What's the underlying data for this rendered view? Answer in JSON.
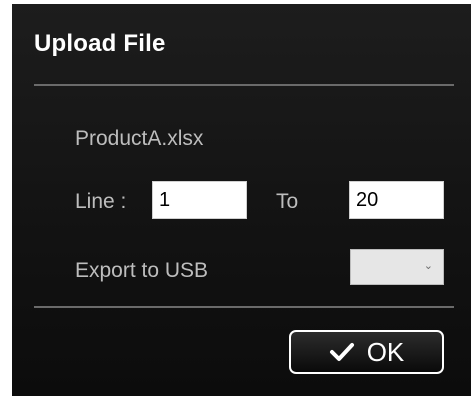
{
  "dialog": {
    "title": "Upload File",
    "filename": "ProductA.xlsx",
    "line_label": "Line :",
    "line_from_value": "1",
    "to_label": "To",
    "line_to_value": "20",
    "export_label": "Export to USB",
    "export_selected": "",
    "ok_label": "OK"
  },
  "icons": {
    "ok": "checkmark-icon",
    "select": "chevron-down-icon"
  },
  "colors": {
    "dialog_bg": "#141414",
    "text": "#bdbdbd",
    "title": "#ffffff",
    "divider": "#6a6a6a"
  }
}
